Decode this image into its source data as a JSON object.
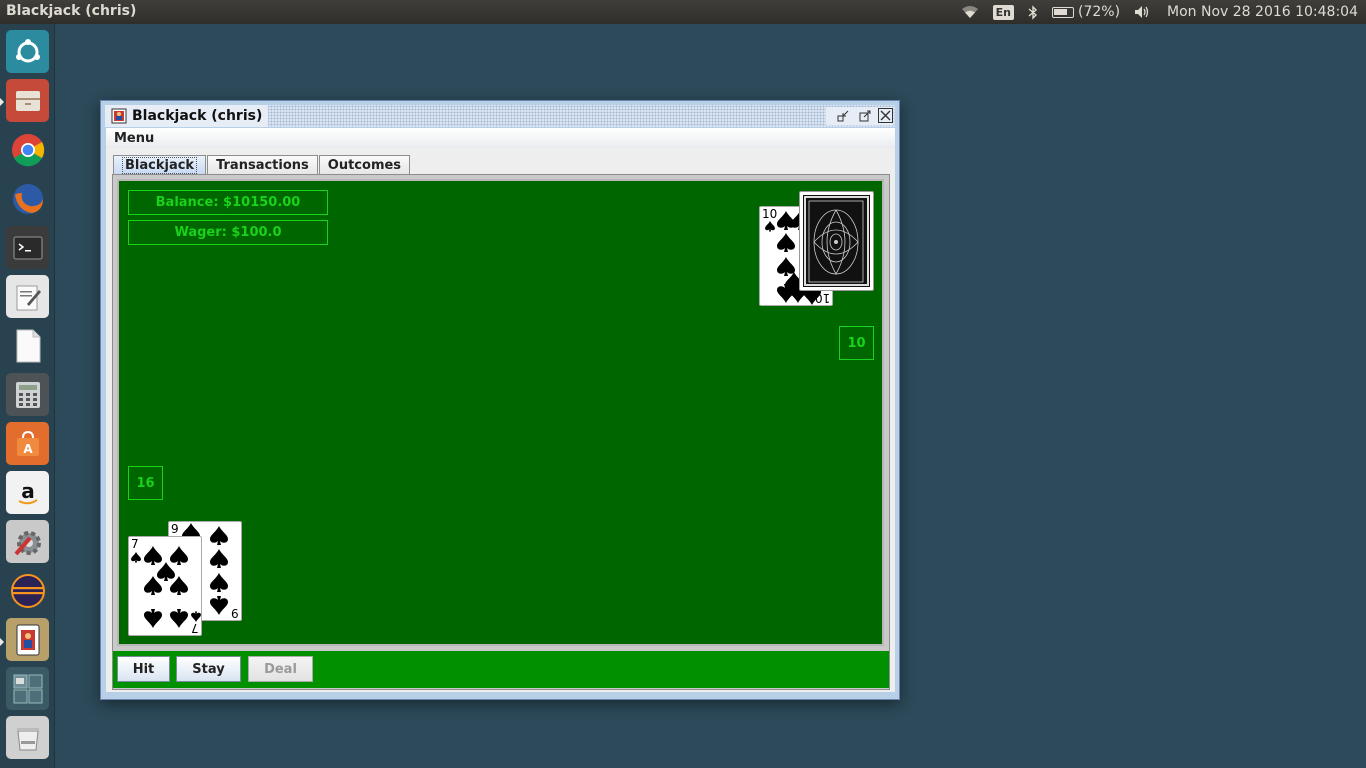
{
  "top_panel": {
    "app_title": "Blackjack (chris)",
    "keyboard_layout": "En",
    "battery": "(72%)",
    "clock": "Mon Nov 28 2016 10:48:04",
    "icons": [
      "wifi-icon",
      "bluetooth-icon",
      "battery-icon",
      "volume-icon"
    ]
  },
  "launcher": {
    "items": [
      {
        "name": "ubuntu-dash-icon",
        "color": "#2b8ca0"
      },
      {
        "name": "files-icon",
        "color": "#c54a3a"
      },
      {
        "name": "chrome-icon",
        "color": "#3f7bd6"
      },
      {
        "name": "firefox-icon",
        "color": "#e8711f"
      },
      {
        "name": "terminal-icon",
        "color": "#3a3a3a"
      },
      {
        "name": "text-editor-icon",
        "color": "#e6e6e6"
      },
      {
        "name": "libreoffice-icon",
        "color": "#f4f4f4"
      },
      {
        "name": "calculator-icon",
        "color": "#4d5257"
      },
      {
        "name": "software-center-icon",
        "color": "#e36d2c"
      },
      {
        "name": "amazon-icon",
        "color": "#f2f2f2"
      },
      {
        "name": "system-settings-icon",
        "color": "#c9c9c9"
      },
      {
        "name": "eclipse-icon",
        "color": "#2c2255"
      },
      {
        "name": "blackjack-app-icon",
        "color": "#b8a06a"
      },
      {
        "name": "workspace-switcher-icon",
        "color": "#3c5a66"
      },
      {
        "name": "trash-icon",
        "color": "#d0d0d0"
      }
    ]
  },
  "window": {
    "title": "Blackjack (chris)",
    "menu_label": "Menu",
    "tabs": [
      {
        "label": "Blackjack",
        "active": true
      },
      {
        "label": "Transactions",
        "active": false
      },
      {
        "label": "Outcomes",
        "active": false
      }
    ]
  },
  "game": {
    "balance": "Balance: $10150.00",
    "wager": "Wager: $100.0",
    "dealer_total": "10",
    "player_total": "16",
    "dealer_cards": [
      {
        "rank": "10",
        "suit": "spades",
        "face_up": true
      },
      {
        "face_up": false
      }
    ],
    "player_cards": [
      {
        "rank": "9",
        "suit": "spades"
      },
      {
        "rank": "7",
        "suit": "spades"
      }
    ],
    "table_color": "#006600",
    "text_color": "#19d21a"
  },
  "controls": {
    "hit_label": "Hit",
    "stay_label": "Stay",
    "deal_label": "Deal",
    "deal_enabled": false
  }
}
